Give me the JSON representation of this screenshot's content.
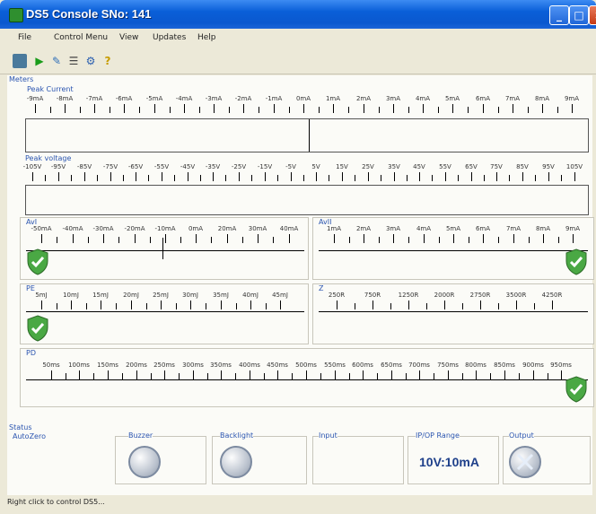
{
  "window": {
    "title": "DS5 Console SNo: 141"
  },
  "menu": [
    "File",
    "Control Menu",
    "View",
    "Updates",
    "Help"
  ],
  "toolbar": {
    "icons": [
      "database-icon",
      "play-icon",
      "edit-icon",
      "list-icon",
      "link-icon",
      "help-icon"
    ]
  },
  "meters": {
    "group_label": "Meters",
    "peak_current": {
      "label": "Peak Current",
      "ticks": [
        "-9mA",
        "-8mA",
        "-7mA",
        "-6mA",
        "-5mA",
        "-4mA",
        "-3mA",
        "-2mA",
        "-1mA",
        "0mA",
        "1mA",
        "2mA",
        "3mA",
        "4mA",
        "5mA",
        "6mA",
        "7mA",
        "8mA",
        "9mA"
      ]
    },
    "peak_voltage": {
      "label": "Peak voltage",
      "ticks": [
        "-105V",
        "-95V",
        "-85V",
        "-75V",
        "-65V",
        "-55V",
        "-45V",
        "-35V",
        "-25V",
        "-15V",
        "-5V",
        "5V",
        "15V",
        "25V",
        "35V",
        "45V",
        "55V",
        "65V",
        "75V",
        "85V",
        "95V",
        "105V"
      ]
    },
    "avi": {
      "label": "AvI",
      "ticks": [
        "-50mA",
        "-40mA",
        "-30mA",
        "-20mA",
        "-10mA",
        "0mA",
        "20mA",
        "30mA",
        "40mA"
      ]
    },
    "avii": {
      "label": "AvII",
      "ticks": [
        "1mA",
        "2mA",
        "3mA",
        "4mA",
        "5mA",
        "6mA",
        "7mA",
        "8mA",
        "9mA"
      ]
    },
    "pe": {
      "label": "PE",
      "ticks": [
        "5mJ",
        "10mJ",
        "15mJ",
        "20mJ",
        "25mJ",
        "30mJ",
        "35mJ",
        "40mJ",
        "45mJ"
      ]
    },
    "z": {
      "label": "Z",
      "ticks": [
        "250R",
        "750R",
        "1250R",
        "2000R",
        "2750R",
        "3500R",
        "4250R"
      ]
    },
    "pd": {
      "label": "PD",
      "ticks": [
        "50ms",
        "100ms",
        "150ms",
        "200ms",
        "250ms",
        "300ms",
        "350ms",
        "400ms",
        "450ms",
        "500ms",
        "550ms",
        "600ms",
        "650ms",
        "700ms",
        "750ms",
        "800ms",
        "850ms",
        "900ms",
        "950ms"
      ]
    }
  },
  "status_group": {
    "label": "Status",
    "autozero": "AutoZero",
    "buzzer": "Buzzer",
    "backlight": "Backlight",
    "input": "Input",
    "range_label": "IP/OP Range",
    "range_value": "10V:10mA",
    "output": "Output"
  },
  "statusbar": {
    "text": "Right click to control DS5..."
  }
}
